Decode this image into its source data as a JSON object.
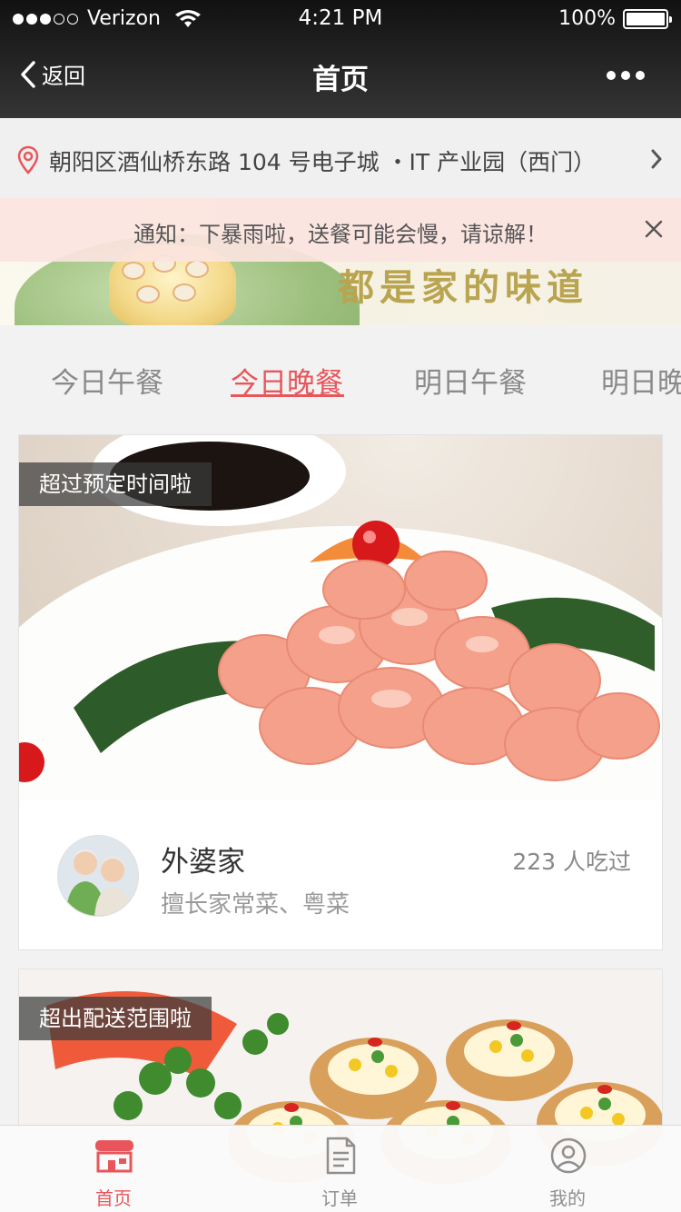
{
  "status_bar": {
    "carrier": "Verizon",
    "time": "4:21 PM",
    "battery": "100%",
    "signal_bars_filled": 3,
    "signal_bars_total": 5
  },
  "nav": {
    "back_label": "返回",
    "title": "首页"
  },
  "address": {
    "text": "朝阳区酒仙桥东路 104 号电子城 ・IT 产业园（西门）"
  },
  "notice": {
    "text": "通知：下暴雨啦，送餐可能会慢，请谅解！"
  },
  "banner": {
    "slogan": "都是家的味道"
  },
  "meal_tabs": [
    {
      "label": "今日午餐",
      "active": false
    },
    {
      "label": "今日晚餐",
      "active": true
    },
    {
      "label": "明日午餐",
      "active": false
    },
    {
      "label": "明日晚餐",
      "active": false
    }
  ],
  "restaurants": [
    {
      "badge": "超过预定时间啦",
      "name": "外婆家",
      "specialty": "擅长家常菜、粤菜",
      "count": "223 人吃过"
    },
    {
      "badge": "超出配送范围啦"
    }
  ],
  "tabbar": {
    "items": [
      {
        "label": "首页",
        "active": true
      },
      {
        "label": "订单",
        "active": false
      },
      {
        "label": "我的",
        "active": false
      }
    ]
  },
  "colors": {
    "accent": "#e8565b",
    "nav_bg": "#2a2a2a",
    "notice_bg": "#fbe4df"
  }
}
